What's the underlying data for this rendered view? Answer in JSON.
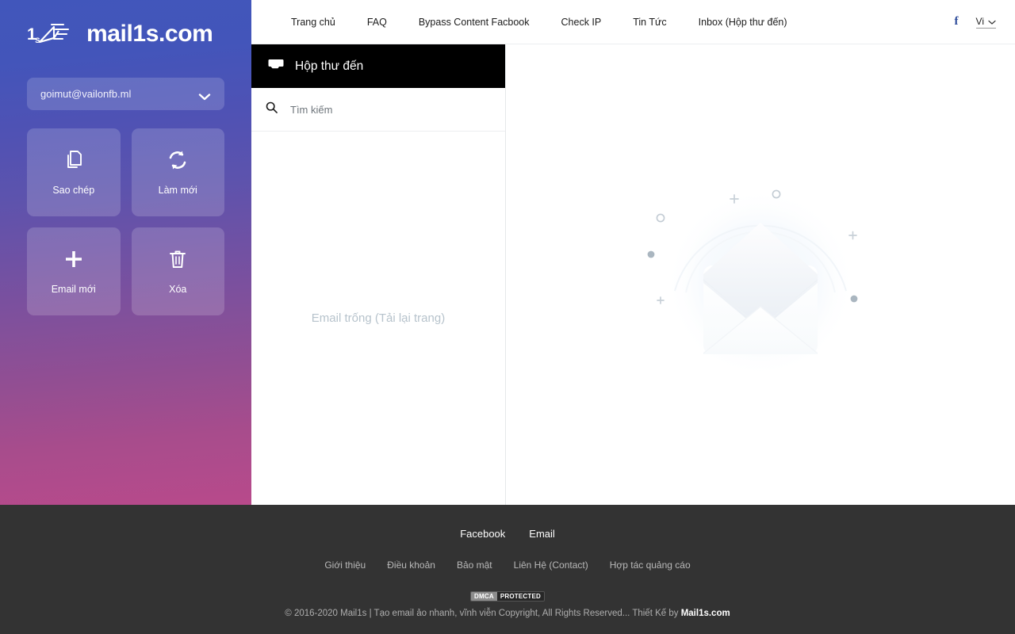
{
  "sidebar": {
    "logo_icon": "mail-speed-logo-icon",
    "logo_text": "mail1s.com",
    "account": {
      "email": "goimut@vailonfb.ml",
      "chevron_icon": "chevron-down-icon"
    },
    "tiles": [
      {
        "label": "Sao chép",
        "icon": "copy-icon"
      },
      {
        "label": "Làm mới",
        "icon": "refresh-icon"
      },
      {
        "label": "Email mới",
        "icon": "plus-icon"
      },
      {
        "label": "Xóa",
        "icon": "trash-icon"
      }
    ]
  },
  "topnav": {
    "items": [
      {
        "label": "Trang chủ"
      },
      {
        "label": "FAQ"
      },
      {
        "label": "Bypass Content Facbook"
      },
      {
        "label": "Check IP"
      },
      {
        "label": "Tin Tức"
      },
      {
        "label": "Inbox (Hộp thư đến)"
      }
    ],
    "facebook_icon": "facebook-f-icon",
    "facebook_glyph": "f",
    "language": {
      "value": "Vi",
      "chevron_icon": "chevron-down-icon"
    }
  },
  "inbox": {
    "header_icon": "inbox-tray-icon",
    "header_title": "Hộp thư đến",
    "search": {
      "icon": "search-icon",
      "placeholder": "Tìm kiếm",
      "value": ""
    },
    "empty_message": "Email trống (Tải lại trang)"
  },
  "main": {
    "illustration_icon": "empty-envelope-illustration"
  },
  "footer": {
    "social": [
      {
        "label": "Facebook"
      },
      {
        "label": "Email"
      }
    ],
    "links": [
      {
        "label": "Giới thiệu"
      },
      {
        "label": "Điều khoản"
      },
      {
        "label": "Bảo mật"
      },
      {
        "label": "Liên Hệ (Contact)"
      },
      {
        "label": "Hợp tác quảng cáo"
      }
    ],
    "dmca": {
      "left": "DMCA",
      "right": "PROTECTED"
    },
    "copyright_text": "© 2016-2020 Mail1s | Tạo email ảo nhanh, vĩnh viễn Copyright, All Rights Reserved... Thiết Kế by ",
    "copyright_brand": "Mail1s.com"
  },
  "colors": {
    "sidebar_top": "#4156bb",
    "sidebar_bottom": "#b84a8b",
    "inbox_header": "#000000",
    "footer_bg": "#333333",
    "empty_text": "#b7c3cc",
    "facebook_blue": "#2d4b9a"
  }
}
